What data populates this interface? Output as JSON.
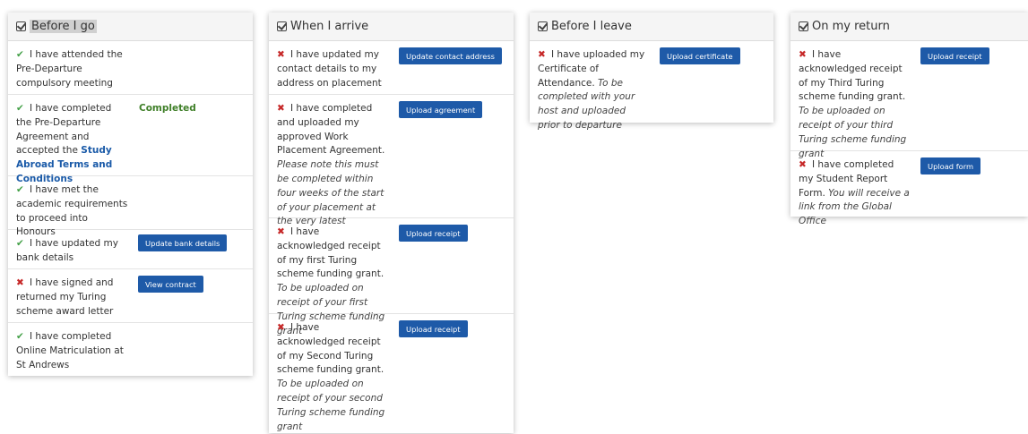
{
  "panels": [
    {
      "title": "Before I go",
      "items": [
        {
          "status": "done",
          "text": "I have attended the Pre-Departure compulsory meeting"
        },
        {
          "status": "done",
          "text": "I have completed the Pre-Departure Agreement and accepted the",
          "link": "Study Abroad Terms and Conditions",
          "badge": "Completed"
        },
        {
          "status": "done",
          "text": "I have met the academic requirements to proceed into Honours"
        },
        {
          "status": "done",
          "text": "I have updated my bank details",
          "button": "Update bank details"
        },
        {
          "status": "todo",
          "text": "I have signed and returned my Turing scheme award letter",
          "button": "View contract"
        },
        {
          "status": "done",
          "text": "I have completed Online Matriculation at St Andrews"
        }
      ]
    },
    {
      "title": "When I arrive",
      "items": [
        {
          "status": "todo",
          "text": "I have updated my contact details to my address on placement",
          "button": "Update contact address"
        },
        {
          "status": "todo",
          "text": "I have completed and uploaded my approved Work Placement Agreement.",
          "note": "Please note this must be completed within four weeks of the start of your placement at the very latest",
          "button": "Upload agreement"
        },
        {
          "status": "todo",
          "text": "I have acknowledged receipt of my first Turing scheme funding grant.",
          "note": "To be uploaded on receipt of your first Turing scheme funding grant",
          "button": "Upload receipt"
        },
        {
          "status": "todo",
          "text": "I have acknowledged receipt of my Second Turing scheme funding grant.",
          "note": "To be uploaded on receipt of your second Turing scheme funding grant",
          "button": "Upload receipt"
        }
      ]
    },
    {
      "title": "Before I leave",
      "items": [
        {
          "status": "todo",
          "text": "I have uploaded my Certificate of Attendance.",
          "note": "To be completed with your host and uploaded prior to departure",
          "button": "Upload certificate"
        }
      ]
    },
    {
      "title": "On my return",
      "items": [
        {
          "status": "todo",
          "text": "I have acknowledged receipt of my Third Turing scheme funding grant.",
          "note": "To be uploaded on receipt of your third Turing scheme funding grant",
          "button": "Upload receipt"
        },
        {
          "status": "todo",
          "text": "I have completed my Student Report Form.",
          "note": "You will receive a link from the Global Office",
          "button": "Upload form"
        }
      ]
    }
  ],
  "icons": {
    "header": "checkbox-icon",
    "done": "tick-icon",
    "todo": "cross-icon"
  },
  "colors": {
    "button": "#1e5aa8",
    "tick": "#43a047",
    "cross": "#c62828",
    "completed": "#3f7f28"
  }
}
